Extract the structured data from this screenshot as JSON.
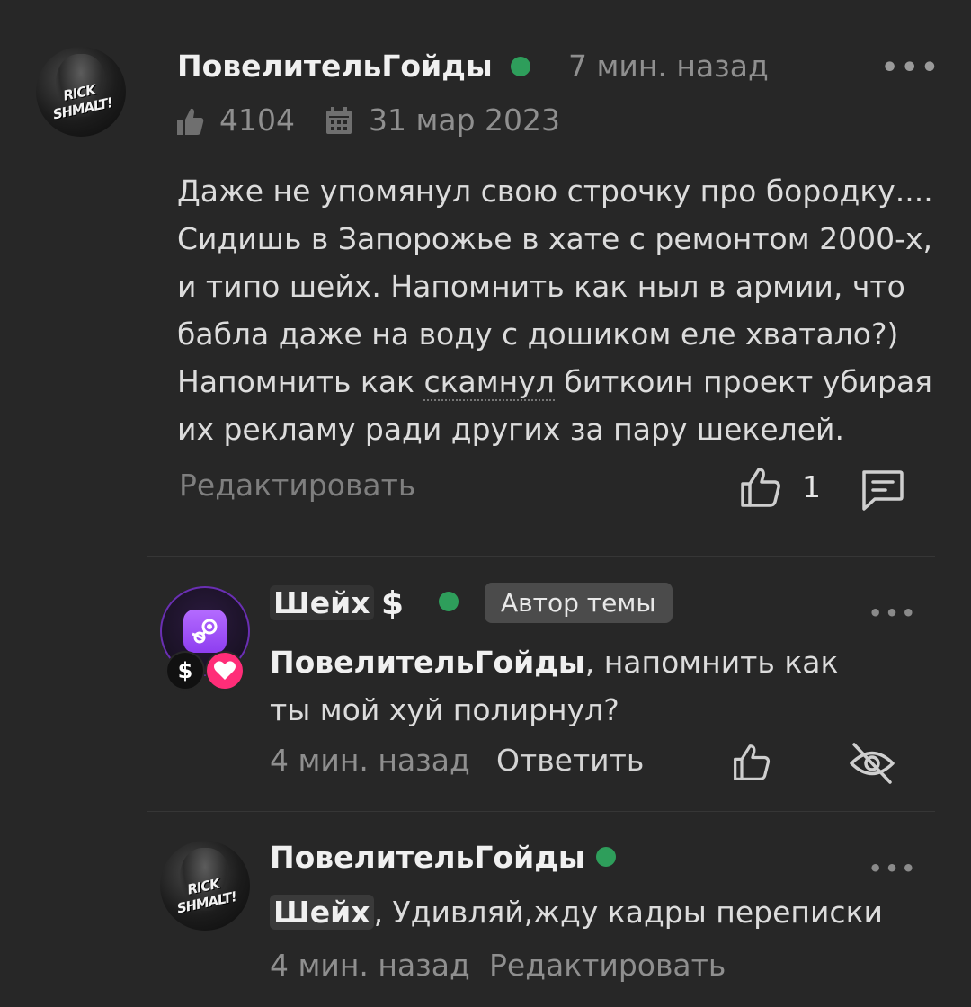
{
  "comment": {
    "author": "ПовелительГойды",
    "avatar_text": "RICK SHMALT!",
    "time": "7 мин. назад",
    "likes": "4104",
    "date": "31 мар 2023",
    "text_lines": [
      "Даже не упомянул свою строчку про бородку....",
      "Сидишь в Запорожье в хате с ремонтом 2000-х,",
      "и типо шейх. Напомнить как ныл в армии, что",
      "бабла даже на воду с дошиком еле хватало?)"
    ],
    "text_line5_pre": "Напомнить как ",
    "text_line5_underlined": "скамнул",
    "text_line5_post": " биткоин проект убирая",
    "text_line6": "их рекламу ради других за пару шекелей.",
    "edit_label": "Редактировать",
    "like_count": "1",
    "more": "•••"
  },
  "reply1": {
    "author": "Шейх",
    "dollar_symbol": "$",
    "author_badge": "Автор темы",
    "badge_dollar": "$",
    "mention": "ПовелительГойды",
    "text_rest": ", напомнить как",
    "text_line2": "ты мой хуй полирнул?",
    "time": "4 мин. назад",
    "reply_label": "Ответить",
    "more": "•••"
  },
  "reply2": {
    "author": "ПовелительГойды",
    "avatar_text": "RICK SHMALT!",
    "mention": "Шейх",
    "text_rest": ", Удивляй,жду кадры переписки",
    "time": "4 мин. назад",
    "edit_label": "Редактировать",
    "more": "•••"
  },
  "colors": {
    "background": "#272727",
    "online": "#2e9e5b",
    "heart_badge": "#ff2d78",
    "steam_purple": "#8e3ef0"
  },
  "icons": [
    "thumbs-up-icon",
    "calendar-icon",
    "like-outline-icon",
    "message-icon",
    "hide-eye-icon",
    "steam-icon",
    "heart-icon",
    "more-icon"
  ]
}
